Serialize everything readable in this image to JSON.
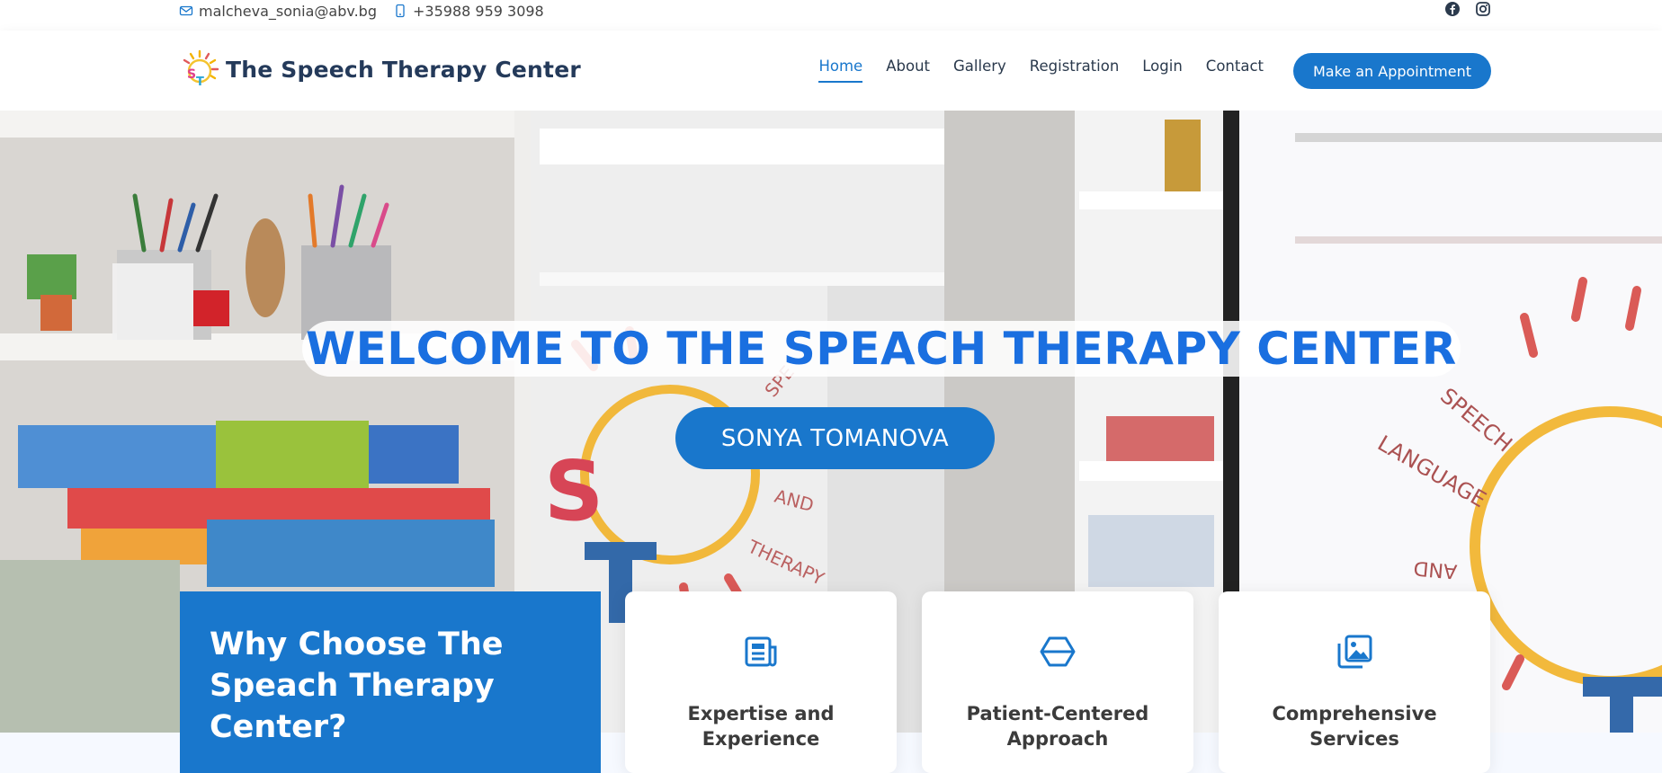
{
  "topbar": {
    "email": "malcheva_sonia@abv.bg",
    "phone": "+35988 959 3098",
    "social": [
      "facebook-icon",
      "instagram-icon"
    ]
  },
  "header": {
    "logo_text": "The Speech Therapy Center",
    "logo_letters": [
      "S",
      "T"
    ],
    "nav": [
      "Home",
      "About",
      "Gallery",
      "Registration",
      "Login",
      "Contact"
    ],
    "active_nav": "Home",
    "appointment_label": "Make an Appointment"
  },
  "hero": {
    "title": "WELCOME TO THE SPEACH THERAPY CENTER",
    "button_label": "SONYA TOMANOVA",
    "sign_words": [
      "SPEECH",
      "LANGUAGE",
      "AND",
      "THERAPY",
      "SPE",
      "AND",
      "THERAPY"
    ]
  },
  "why": {
    "title": "Why Choose The Speach Therapy Center?"
  },
  "cards": [
    {
      "title": "Expertise and Experience",
      "icon": "document-icon"
    },
    {
      "title": "Patient-Centered Approach",
      "icon": "cube-icon"
    },
    {
      "title": "Comprehensive Services",
      "icon": "images-icon"
    }
  ],
  "colors": {
    "accent": "#1977cc",
    "hero_title": "#1a6fe0",
    "heading_dark": "#243a5a"
  }
}
